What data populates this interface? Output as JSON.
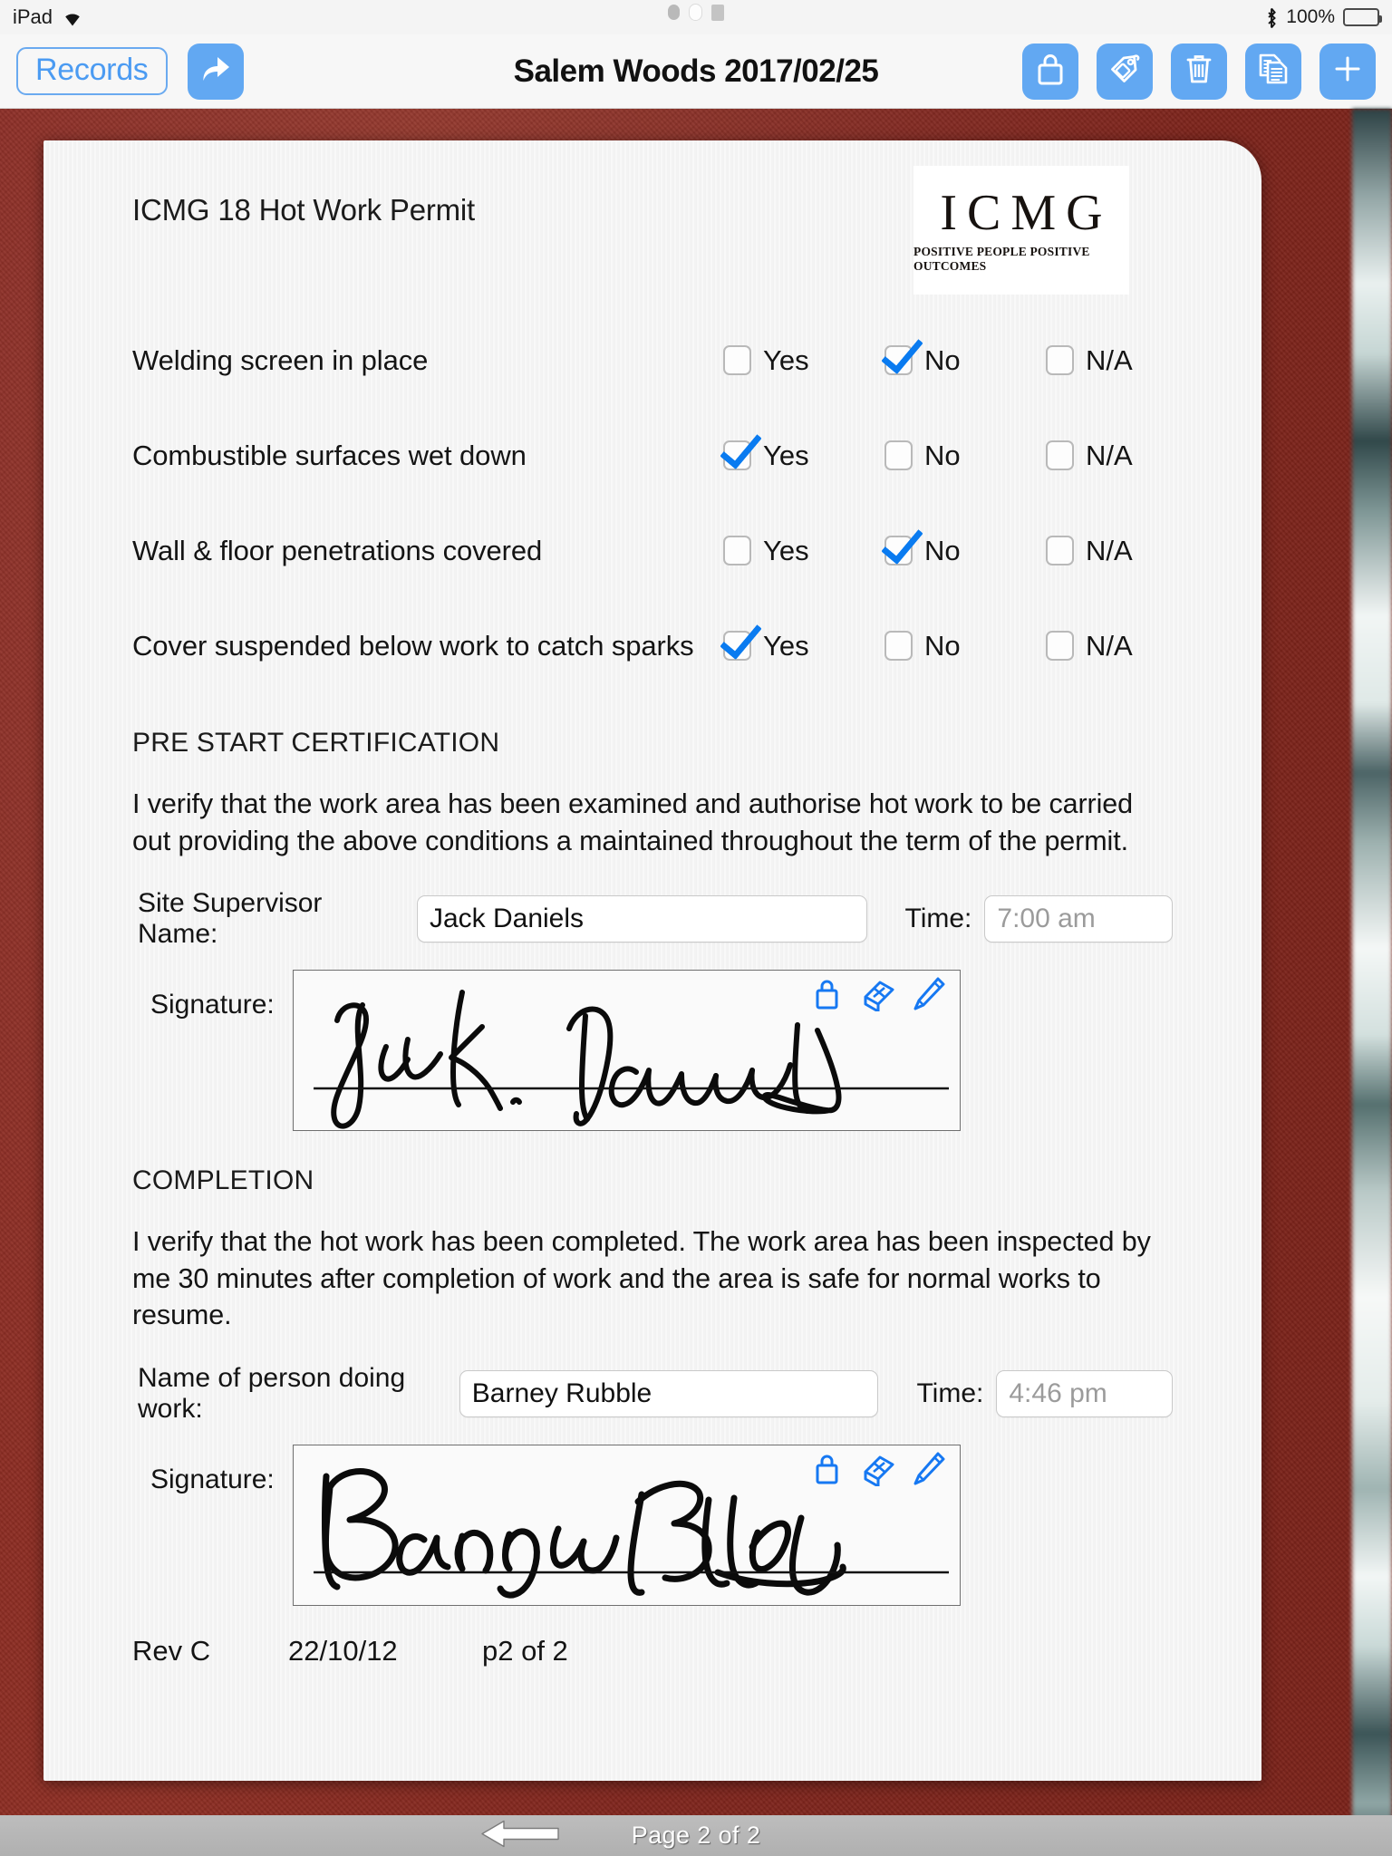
{
  "status_bar": {
    "device": "iPad",
    "wifi_icon": "wifi-icon",
    "bluetooth_icon": "bluetooth-icon",
    "battery_percent": "100%",
    "battery_icon": "battery-full-icon"
  },
  "navbar": {
    "back_label": "Records",
    "share_icon": "share-arrow-icon",
    "title": "Salem Woods 2017/02/25",
    "actions": [
      {
        "name": "lock-icon",
        "label": "Lock"
      },
      {
        "name": "tag-icon",
        "label": "Tag"
      },
      {
        "name": "trash-icon",
        "label": "Delete"
      },
      {
        "name": "duplicate-icon",
        "label": "Duplicate"
      },
      {
        "name": "plus-icon",
        "label": "Add"
      }
    ]
  },
  "document": {
    "title": "ICMG 18 Hot Work Permit",
    "logo": {
      "main": "ICMG",
      "tagline": "POSITIVE PEOPLE POSITIVE OUTCOMES"
    },
    "checklist": {
      "options": [
        "Yes",
        "No",
        "N/A"
      ],
      "rows": [
        {
          "label": "Welding screen in place",
          "checked": "No"
        },
        {
          "label": "Combustible surfaces wet down",
          "checked": "Yes"
        },
        {
          "label": "Wall & floor penetrations covered",
          "checked": "No"
        },
        {
          "label": "Cover suspended below work to catch sparks",
          "checked": "Yes"
        }
      ]
    },
    "pre_start": {
      "heading": "PRE START CERTIFICATION",
      "body": "I verify that the work area has been examined and authorise hot work to be carried out providing the above conditions a maintained throughout the term of the permit.",
      "name_label": "Site Supervisor Name:",
      "name_value": "Jack Daniels",
      "time_label": "Time:",
      "time_value": "7:00 am",
      "signature_label": "Signature:",
      "signature_name": "Jack Daniels",
      "signature_tools": [
        "lock-icon",
        "eraser-icon",
        "pen-icon"
      ]
    },
    "completion": {
      "heading": "COMPLETION",
      "body": "I verify that the hot work has been completed. The work area has been inspected by me 30 minutes after completion of work and the area is safe for normal works to resume.",
      "name_label": "Name of person doing work:",
      "name_value": "Barney Rubble",
      "time_label": "Time:",
      "time_value": "4:46 pm",
      "signature_label": "Signature:",
      "signature_name": "Barney Rubble",
      "signature_tools": [
        "lock-icon",
        "eraser-icon",
        "pen-icon"
      ]
    },
    "footer": {
      "revision": "Rev C",
      "date": "22/10/12",
      "page": "p2 of 2"
    }
  },
  "page_bar": {
    "back_icon": "left-arrow-icon",
    "label": "Page 2 of 2"
  },
  "colors": {
    "accent_blue": "#62a8f2",
    "check_blue": "#0a7bf0",
    "desk_red": "#8a2a22"
  }
}
